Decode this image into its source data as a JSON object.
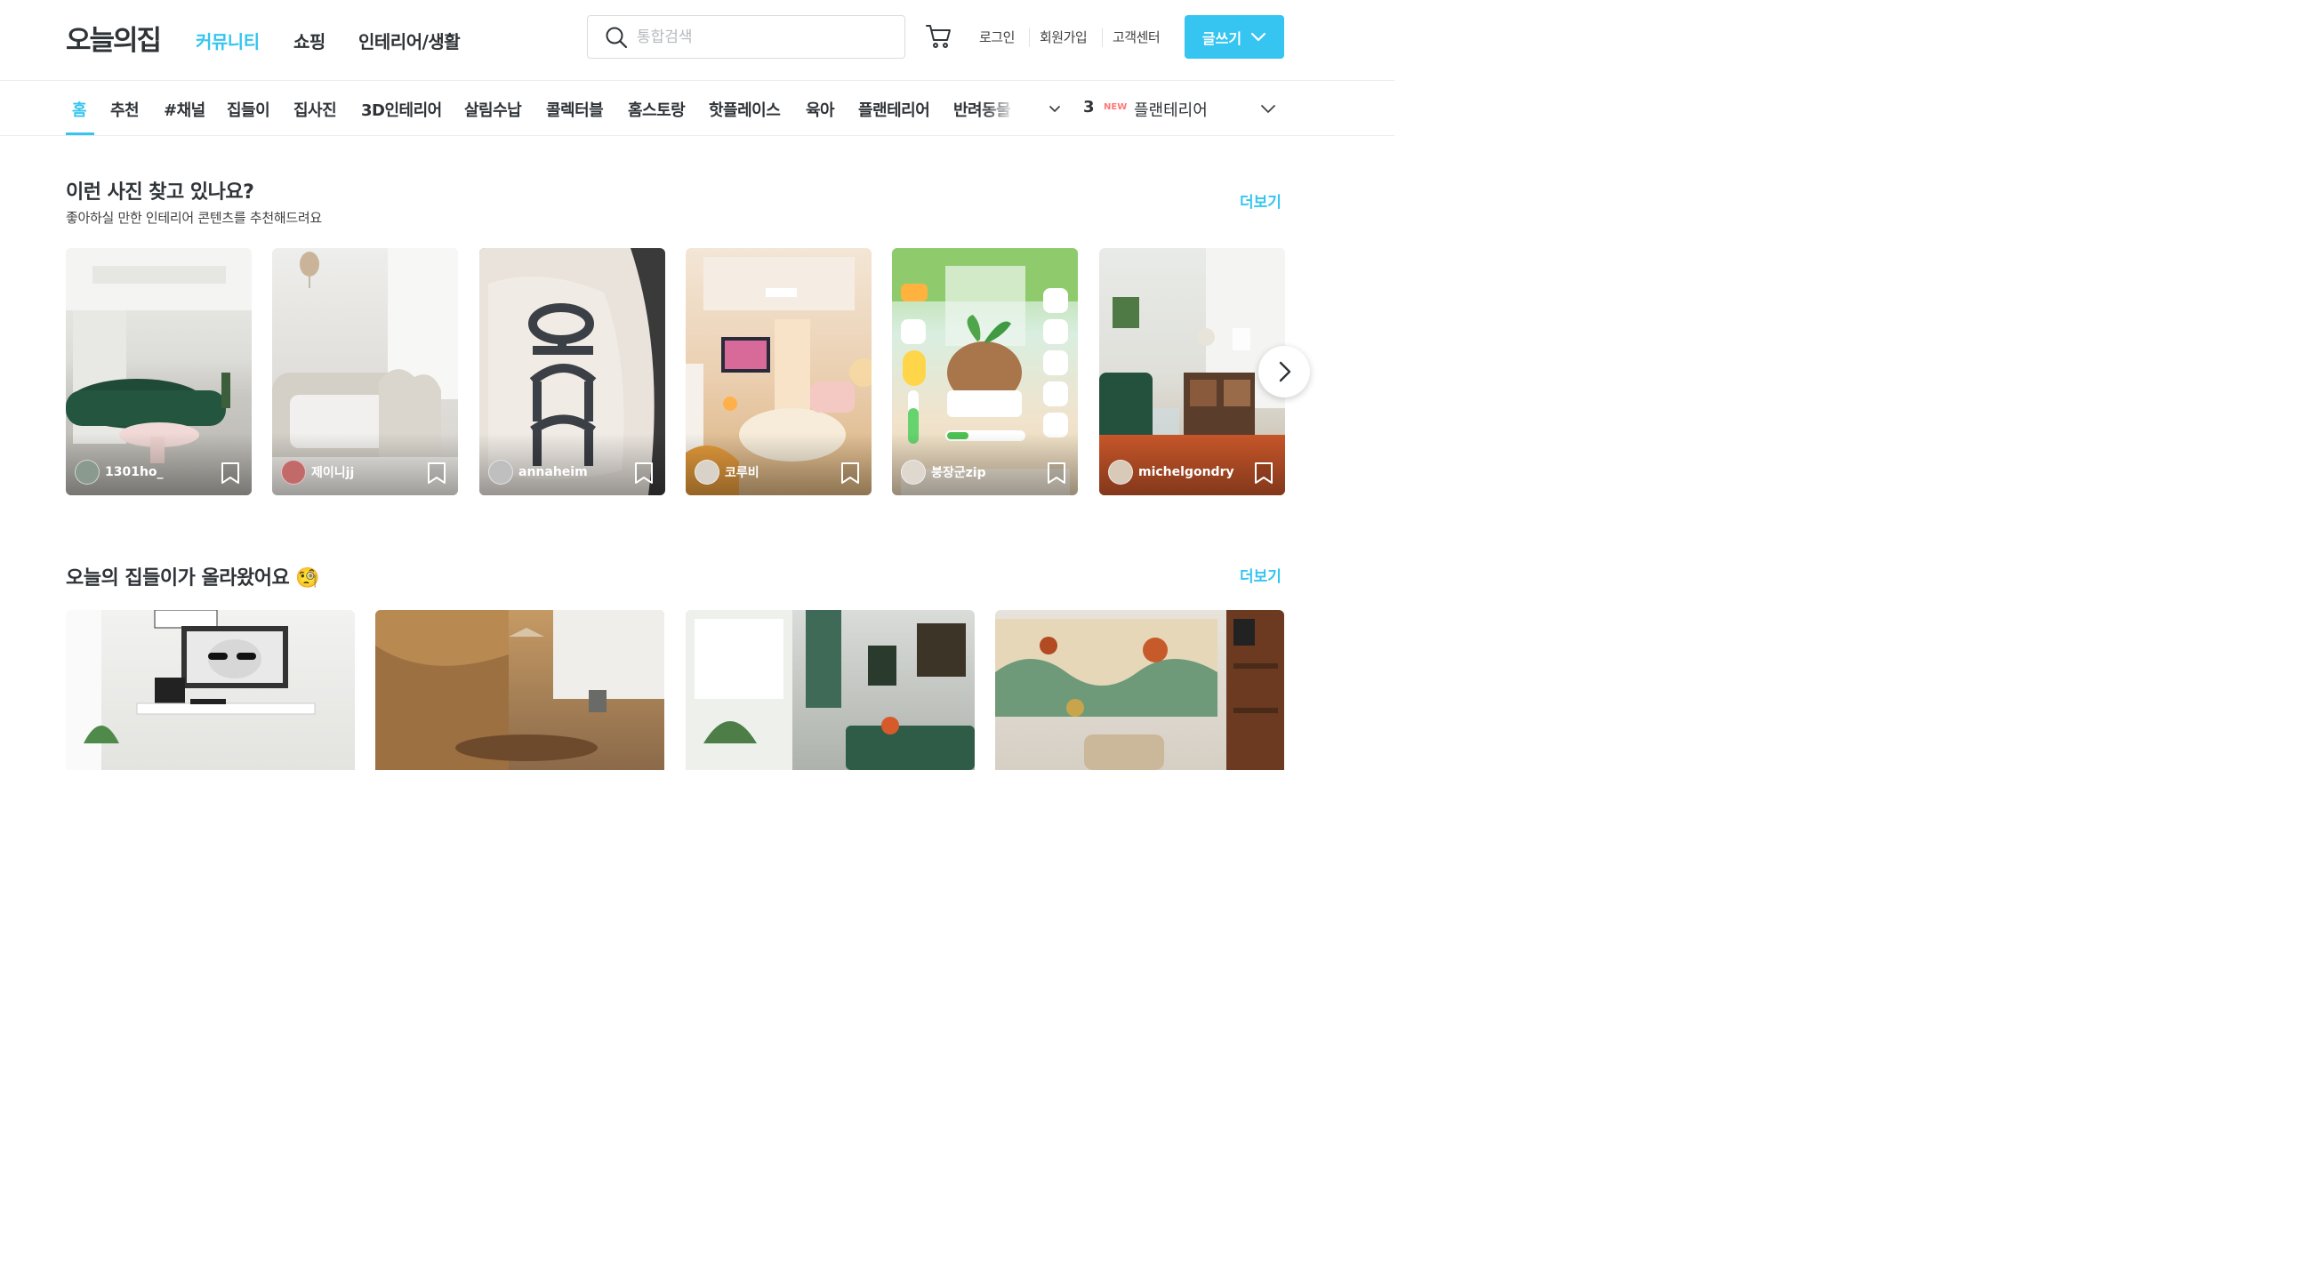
{
  "header": {
    "logo": "오늘의집",
    "nav": [
      {
        "label": "커뮤니티",
        "active": true
      },
      {
        "label": "쇼핑",
        "active": false
      },
      {
        "label": "인테리어/생활",
        "active": false
      }
    ],
    "search_placeholder": "통합검색",
    "util_links": [
      "로그인",
      "회원가입",
      "고객센터"
    ],
    "write_button": "글쓰기"
  },
  "subnav": {
    "items": [
      "홈",
      "추천",
      "#채널",
      "집들이",
      "집사진",
      "3D인테리어",
      "살림수납",
      "콜렉터블",
      "홈스토랑",
      "핫플레이스",
      "육아",
      "플랜테리어",
      "반려동물"
    ],
    "active_index": 0,
    "ranking": {
      "rank": "3",
      "badge": "NEW",
      "keyword": "플랜테리어"
    }
  },
  "section_photos": {
    "title": "이런 사진 찾고 있나요?",
    "subtitle": "좋아하실 만한 인테리어 콘텐츠를 추천해드려요",
    "more": "더보기",
    "cards": [
      {
        "username": "1301ho_"
      },
      {
        "username": "제이니jj"
      },
      {
        "username": "annaheim"
      },
      {
        "username": "코루비"
      },
      {
        "username": "붕장군zip"
      },
      {
        "username": "michelgondry"
      }
    ]
  },
  "section_houses": {
    "title": "오늘의 집들이가 올라왔어요",
    "emoji": "🧐",
    "more": "더보기",
    "cards": [
      {},
      {},
      {},
      {}
    ]
  },
  "colors": {
    "accent": "#35c5f0",
    "text": "#2f3438",
    "new_badge": "#ff7777"
  },
  "icons": [
    "search-icon",
    "cart-icon",
    "chevron-down-icon",
    "bookmark-icon",
    "chevron-right-icon"
  ]
}
